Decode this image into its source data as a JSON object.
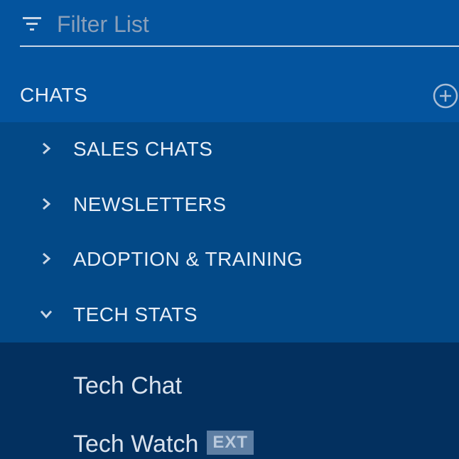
{
  "filter": {
    "placeholder": "Filter List",
    "icon": "filter-icon"
  },
  "chats": {
    "title": "CHATS",
    "add_icon": "plus-circle-icon"
  },
  "groups": [
    {
      "label": "SALES CHATS",
      "expanded": false
    },
    {
      "label": "NEWSLETTERS",
      "expanded": false
    },
    {
      "label": "ADOPTION & TRAINING",
      "expanded": false
    },
    {
      "label": "TECH STATS",
      "expanded": true
    }
  ],
  "channels": [
    {
      "label": "Tech Chat",
      "badge": ""
    },
    {
      "label": "Tech Watch",
      "badge": "EXT"
    }
  ],
  "colors": {
    "header_bg": "#04549e",
    "groups_bg": "#034987",
    "channels_bg": "#03305f",
    "badge_bg": "#5d7ea3"
  }
}
